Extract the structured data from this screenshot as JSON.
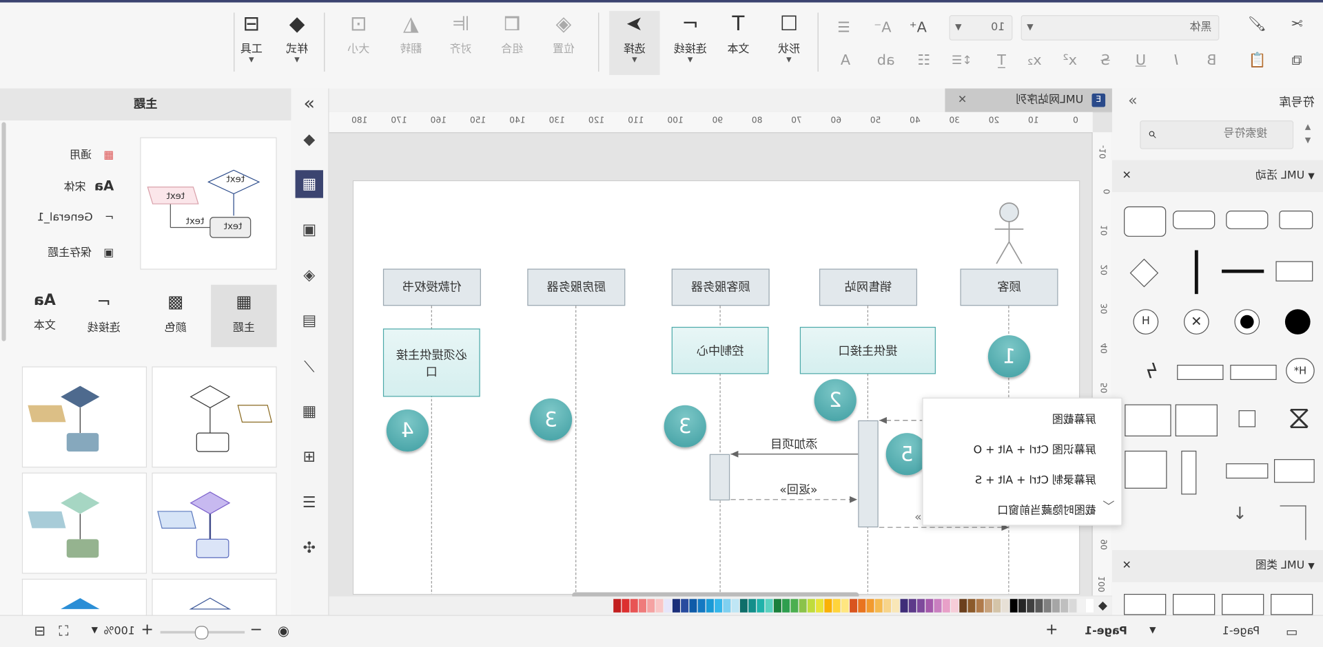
{
  "toolbar": {
    "font_name": "黑体",
    "font_size": "10",
    "buttons": {
      "shape": "形状",
      "text": "文本",
      "connector": "连接线",
      "select": "选择",
      "position": "位置",
      "group": "组合",
      "align": "对齐",
      "flip": "翻转",
      "size": "大小",
      "style": "样式",
      "tools": "工具"
    },
    "icons": {
      "cut": "✂",
      "copy": "⧉",
      "format_painter": "🖌",
      "paste": "📋",
      "bold": "B",
      "italic": "I",
      "underline": "U",
      "strike": "S",
      "superscript": "x²",
      "subscript": "x₂",
      "text_format": "T̲",
      "line_spacing": "↕☰",
      "list": "☷",
      "ab": "ab",
      "font_color": "A",
      "grow": "A⁺",
      "shrink": "A⁻",
      "align": "☰"
    }
  },
  "library": {
    "title": "符号库",
    "search_placeholder": "搜索符号",
    "sections": [
      "UML 活动",
      "UML 类图"
    ]
  },
  "document": {
    "tab": "UML网站序列"
  },
  "ruler": {
    "h": [
      "0",
      "10",
      "20",
      "30",
      "40",
      "50",
      "60",
      "70",
      "80",
      "90",
      "100",
      "110",
      "120",
      "130",
      "140",
      "150",
      "160",
      "170",
      "180"
    ],
    "v": [
      "-10",
      "0",
      "10",
      "20",
      "30",
      "40",
      "50",
      "60",
      "70",
      "80",
      "90",
      "100"
    ]
  },
  "diagram": {
    "lifelines": [
      "顾客",
      "销售网站",
      "顾客服务器",
      "厨房服务器",
      "付款授权书"
    ],
    "notes": [
      "提供主接口",
      "控制中心",
      "必须提供主接口"
    ],
    "steps": [
      "1",
      "2",
      "5",
      "3",
      "3",
      "4"
    ],
    "messages": [
      "添加项目",
      "«返回»",
      "添加项目",
      "«返回»"
    ]
  },
  "context_menu": {
    "items": [
      "屏幕截图",
      "屏幕识图 Ctrl + Alt + O",
      "屏幕录制 Ctrl + Alt + S",
      "截图时隐藏当前窗口"
    ]
  },
  "theme_panel": {
    "title": "主题",
    "list": [
      "通用",
      "宋体",
      "General_1",
      "保存主题"
    ],
    "tabs": [
      "主题",
      "颜色",
      "连接线",
      "文本"
    ],
    "preview_text": "text"
  },
  "palette": [
    "#ffffff",
    "#f2f2f2",
    "#d9d9d9",
    "#bfbfbf",
    "#a6a6a6",
    "#808080",
    "#595959",
    "#404040",
    "#262626",
    "#000000",
    "#e7e0d6",
    "#d4c4a8",
    "#c8a27c",
    "#b07a4a",
    "#8c5a2b",
    "#6b3f1d",
    "#f6cdd8",
    "#e8a0c8",
    "#c97fc0",
    "#a45aab",
    "#7e4a9c",
    "#5d3a8a",
    "#3f2d78",
    "#f9e7b7",
    "#f7d48a",
    "#f5b94f",
    "#f29a2e",
    "#e9741f",
    "#d9541e",
    "#ffe680",
    "#ffd43b",
    "#fab005",
    "#e8e337",
    "#c0dc3c",
    "#8bc34a",
    "#4caf50",
    "#2e9e4f",
    "#1b7f3b",
    "#5ad1c0",
    "#20b2aa",
    "#138f8a",
    "#0f6e6a",
    "#bfe6f5",
    "#7fd0f0",
    "#35b6ea",
    "#1a9ad6",
    "#1479c2",
    "#0f5ba8",
    "#284b9e",
    "#1b2f7a",
    "#e6e6fa",
    "#f9c6c6",
    "#f5a3a3",
    "#ef7b7b",
    "#e85454",
    "#dc3030",
    "#c21f1f"
  ],
  "status": {
    "page_label": "Page-1",
    "page_tab": "Page-1",
    "add": "+",
    "zoom": "100%",
    "zoom_level": 0.5
  }
}
